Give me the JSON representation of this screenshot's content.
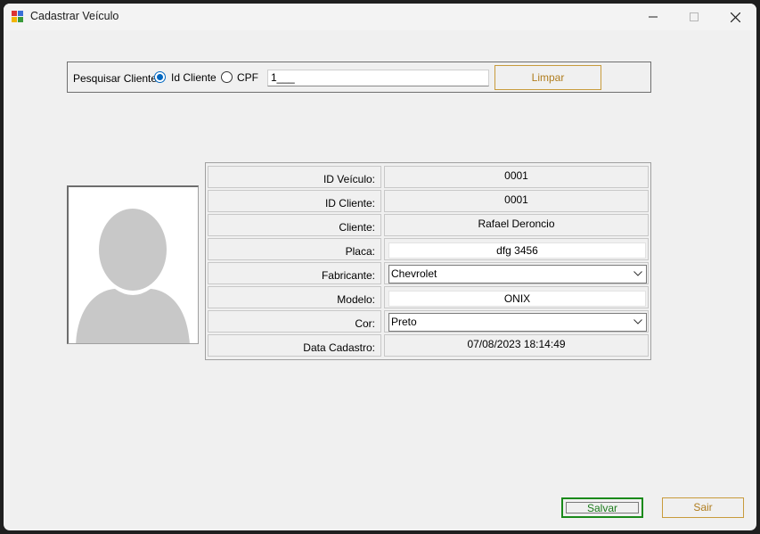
{
  "window": {
    "title": "Cadastrar Veículo",
    "controls": {
      "minimize": "minimize-icon",
      "maximize": "maximize-icon",
      "close": "close-icon"
    }
  },
  "search": {
    "label": "Pesquisar Cliente",
    "options": [
      {
        "label": "Id Cliente",
        "checked": true
      },
      {
        "label": "CPF",
        "checked": false
      }
    ],
    "value": "1___",
    "clear_label": "Limpar"
  },
  "photo": {
    "icon": "user-silhouette-icon"
  },
  "fields": [
    {
      "label": "ID Veículo:",
      "value": "0001",
      "kind": "readonly"
    },
    {
      "label": "ID Cliente:",
      "value": "0001",
      "kind": "readonly"
    },
    {
      "label": "Cliente:",
      "value": "Rafael Deroncio",
      "kind": "readonly"
    },
    {
      "label": "Placa:",
      "value": "dfg 3456",
      "kind": "input"
    },
    {
      "label": "Fabricante:",
      "value": "Chevrolet",
      "kind": "select"
    },
    {
      "label": "Modelo:",
      "value": "ONIX",
      "kind": "input"
    },
    {
      "label": "Cor:",
      "value": "Preto",
      "kind": "select"
    },
    {
      "label": "Data Cadastro:",
      "value": "07/08/2023 18:14:49",
      "kind": "readonly"
    }
  ],
  "actions": {
    "save_label": "Salvar",
    "exit_label": "Sair"
  },
  "colors": {
    "accent_gold": "#c89b3c",
    "save_green": "#1a8a1a",
    "radio_blue": "#0067c0"
  }
}
